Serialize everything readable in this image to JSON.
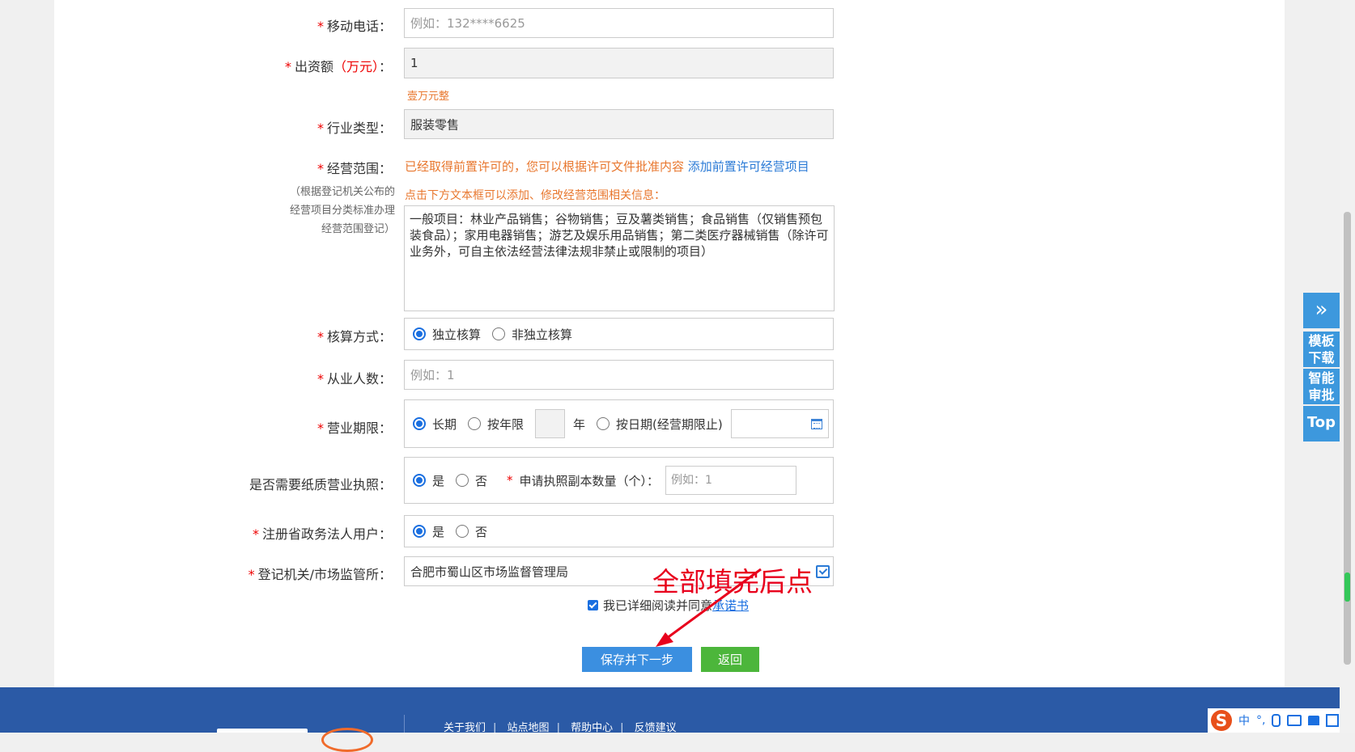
{
  "form": {
    "mobile": {
      "label": "移动电话：",
      "placeholder": "例如：132****6625"
    },
    "capital": {
      "label": "出资额",
      "unit": "（万元）",
      "colon": "：",
      "value": "1",
      "hint": "壹万元整"
    },
    "industry": {
      "label": "行业类型：",
      "value": "服装零售"
    },
    "scope": {
      "label": "经营范围：",
      "note": "（根据登记机关公布的经营项目分类标准办理经营范围登记）",
      "hint1": "已经取得前置许可的，您可以根据许可文件批准内容",
      "hint1_link": "添加前置许可经营项目",
      "hint2": "点击下方文本框可以添加、修改经营范围相关信息：",
      "value": "一般项目：林业产品销售；谷物销售；豆及薯类销售；食品销售（仅销售预包装食品）；家用电器销售；游艺及娱乐用品销售；第二类医疗器械销售（除许可业务外，可自主依法经营法律法规非禁止或限制的项目）"
    },
    "accounting": {
      "label": "核算方式：",
      "options": [
        "独立核算",
        "非独立核算"
      ]
    },
    "employees": {
      "label": "从业人数：",
      "placeholder": "例如：1"
    },
    "term": {
      "label": "营业期限：",
      "opt_long": "长期",
      "opt_year": "按年限",
      "year_unit": "年",
      "opt_date": "按日期(经营期限止)"
    },
    "paper_license": {
      "label": "是否需要纸质营业执照：",
      "yes": "是",
      "no": "否",
      "copies_label": "申请执照副本数量（个）：",
      "copies_placeholder": "例如：1"
    },
    "gov_user": {
      "label": "注册省政务法人用户：",
      "yes": "是",
      "no": "否"
    },
    "authority": {
      "label": "登记机关/市场监管所：",
      "value": "合肥市蜀山区市场监督管理局"
    },
    "agree": {
      "text": "我已详细阅读并同意",
      "link": "承诺书"
    }
  },
  "annotation": "全部填完后点",
  "buttons": {
    "save": "保存并下一步",
    "back": "返回"
  },
  "sidebar": {
    "expand": "»",
    "template": "模板下载",
    "ai": "智能审批",
    "top": "Top"
  },
  "footer": {
    "links": [
      "关于我们",
      "站点地图",
      "帮助中心",
      "反馈建议"
    ]
  },
  "ime": {
    "logo": "S",
    "lang": "中",
    "punct": "°,"
  }
}
